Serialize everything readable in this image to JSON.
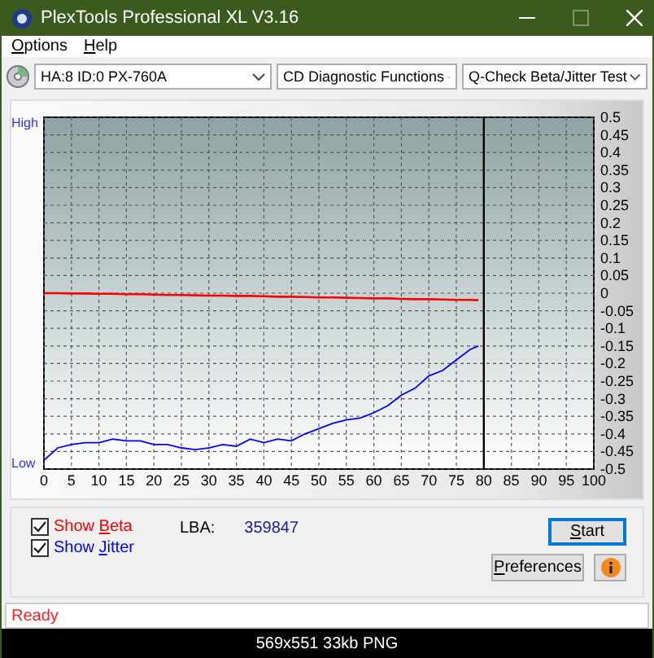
{
  "window": {
    "title": "PlexTools Professional XL V3.16"
  },
  "menu": [
    {
      "label": "Options"
    },
    {
      "label": "Help"
    }
  ],
  "toolbar": {
    "dropdowns": [
      {
        "value": "HA:8 ID:0  PX-760A",
        "kind": "drive"
      },
      {
        "value": "CD Diagnostic Functions",
        "kind": "plain"
      },
      {
        "value": "Q-Check Beta/Jitter Test",
        "kind": "plain"
      }
    ]
  },
  "chart": {
    "high_label": "High",
    "low_label": "Low",
    "chart_data": {
      "type": "line",
      "x": [
        0,
        2.5,
        5,
        7.5,
        10,
        12.5,
        15,
        17.5,
        20,
        22.5,
        25,
        27.5,
        30,
        32.5,
        35,
        37.5,
        40,
        42.5,
        45,
        47.5,
        50,
        52.5,
        55,
        57.5,
        60,
        62.5,
        65,
        67.5,
        70,
        72.5,
        75,
        77.5,
        79
      ],
      "series": [
        {
          "color": "#ff0000",
          "values": [
            0,
            0,
            -0.001,
            -0.001,
            -0.002,
            -0.002,
            -0.003,
            -0.003,
            -0.004,
            -0.005,
            -0.005,
            -0.006,
            -0.007,
            -0.007,
            -0.008,
            -0.008,
            -0.009,
            -0.01,
            -0.01,
            -0.011,
            -0.012,
            -0.012,
            -0.013,
            -0.014,
            -0.015,
            -0.015,
            -0.016,
            -0.017,
            -0.017,
            -0.018,
            -0.019,
            -0.019,
            -0.02
          ]
        },
        {
          "color": "#0000ff",
          "values": [
            -0.475,
            -0.44,
            -0.43,
            -0.425,
            -0.425,
            -0.415,
            -0.42,
            -0.42,
            -0.43,
            -0.43,
            -0.44,
            -0.445,
            -0.44,
            -0.43,
            -0.435,
            -0.415,
            -0.425,
            -0.415,
            -0.42,
            -0.4,
            -0.385,
            -0.37,
            -0.36,
            -0.355,
            -0.34,
            -0.32,
            -0.29,
            -0.27,
            -0.235,
            -0.22,
            -0.19,
            -0.16,
            -0.15
          ]
        }
      ],
      "xlim": [
        0,
        100
      ],
      "ylim": [
        -0.5,
        0.5
      ],
      "xticks": [
        0,
        5,
        10,
        15,
        20,
        25,
        30,
        35,
        40,
        45,
        50,
        55,
        60,
        65,
        70,
        75,
        80,
        85,
        90,
        95,
        100
      ],
      "yticks": [
        0.5,
        0.45,
        0.4,
        0.35,
        0.3,
        0.25,
        0.2,
        0.15,
        0.1,
        0.05,
        0,
        -0.05,
        -0.1,
        -0.15,
        -0.2,
        -0.25,
        -0.3,
        -0.35,
        -0.4,
        -0.45,
        -0.5
      ],
      "grid": true,
      "ref_lines": [
        {
          "axis": "x",
          "value": 80
        }
      ]
    }
  },
  "options": {
    "checkboxes": [
      {
        "label": "Show Beta",
        "checked": true,
        "color": "#ff0000"
      },
      {
        "label": "Show Jitter",
        "checked": true,
        "color": "#0000ff"
      }
    ],
    "lba_label": "LBA:",
    "lba_value": "359847",
    "buttons": [
      {
        "label": "Start",
        "kind": "default"
      },
      {
        "label": "Preferences",
        "kind": "plain"
      },
      {
        "kind": "info"
      }
    ]
  },
  "status_bar": {
    "text": "Ready"
  },
  "caption": "569x551 33kb PNG"
}
